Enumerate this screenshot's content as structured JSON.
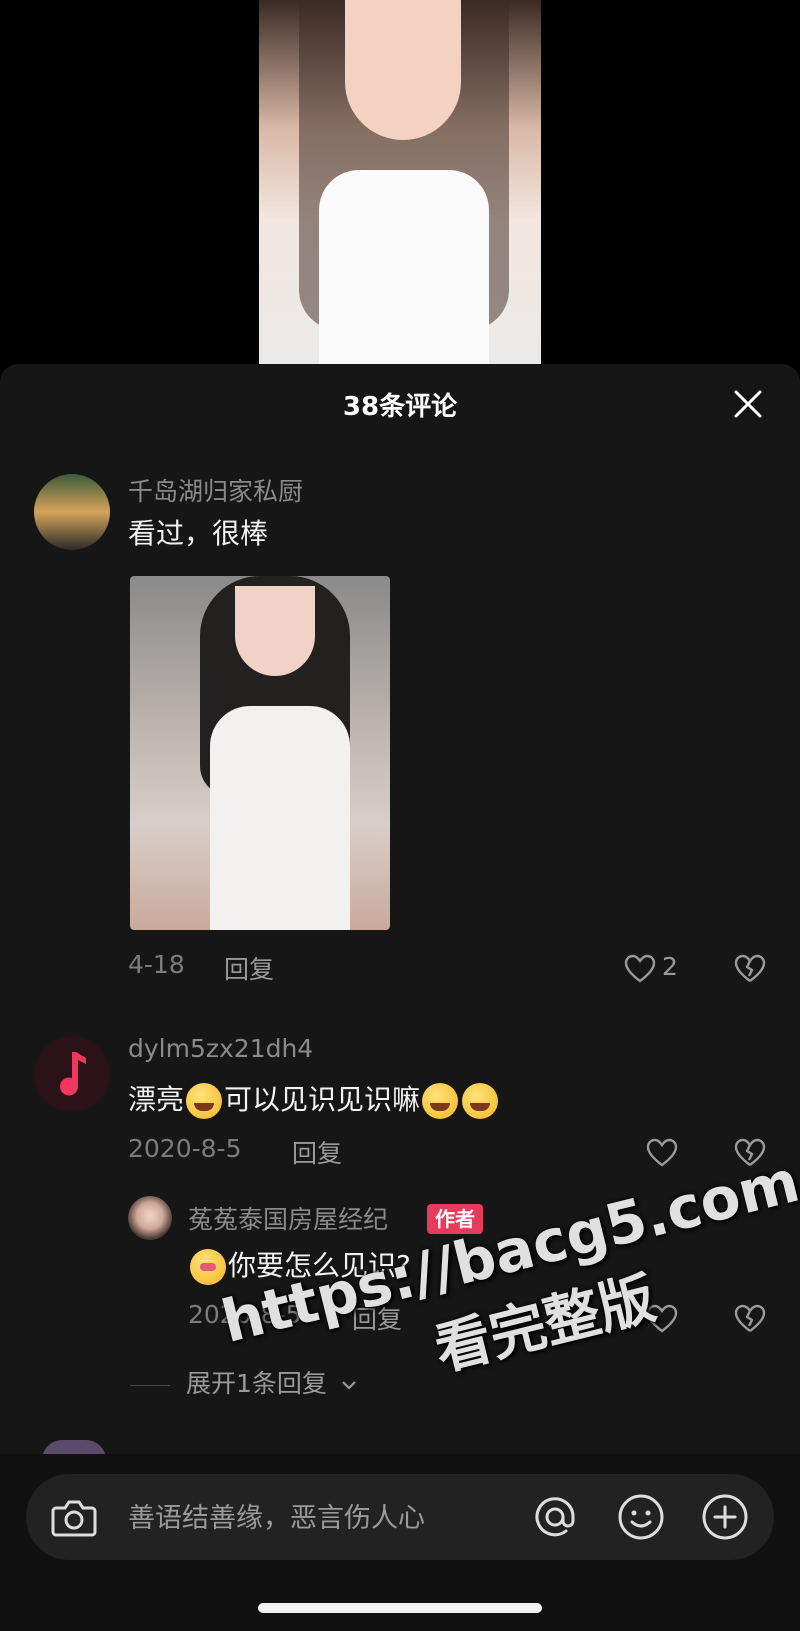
{
  "header": {
    "title": "38条评论"
  },
  "comments": [
    {
      "user": "千岛湖归家私厨",
      "text": "看过，很棒",
      "date": "4-18",
      "reply": "回复",
      "likes": "2"
    },
    {
      "user": "dylm5zx21dh4",
      "text_before": "漂亮",
      "text_after": "可以见识见识嘛",
      "date": "2020-8-5",
      "reply": "回复"
    }
  ],
  "reply": {
    "user": "菟菟泰国房屋经纪",
    "badge": "作者",
    "text": "你要怎么见识?",
    "date": "2020-8-5",
    "reply": "回复"
  },
  "expand": {
    "label": "展开1条回复"
  },
  "input": {
    "placeholder": "善语结善缘，恶言伤人心"
  },
  "watermark": {
    "line1": "https://bacg5.com",
    "line2": "看完整版"
  },
  "colors": {
    "sheet": "#161616",
    "badge": "#e83a5c",
    "muted": "#8a8a8a"
  },
  "icons": [
    "close-icon",
    "heart-icon",
    "broken-heart-icon",
    "camera-icon",
    "at-icon",
    "emoji-icon",
    "plus-icon",
    "chevron-down-icon"
  ]
}
